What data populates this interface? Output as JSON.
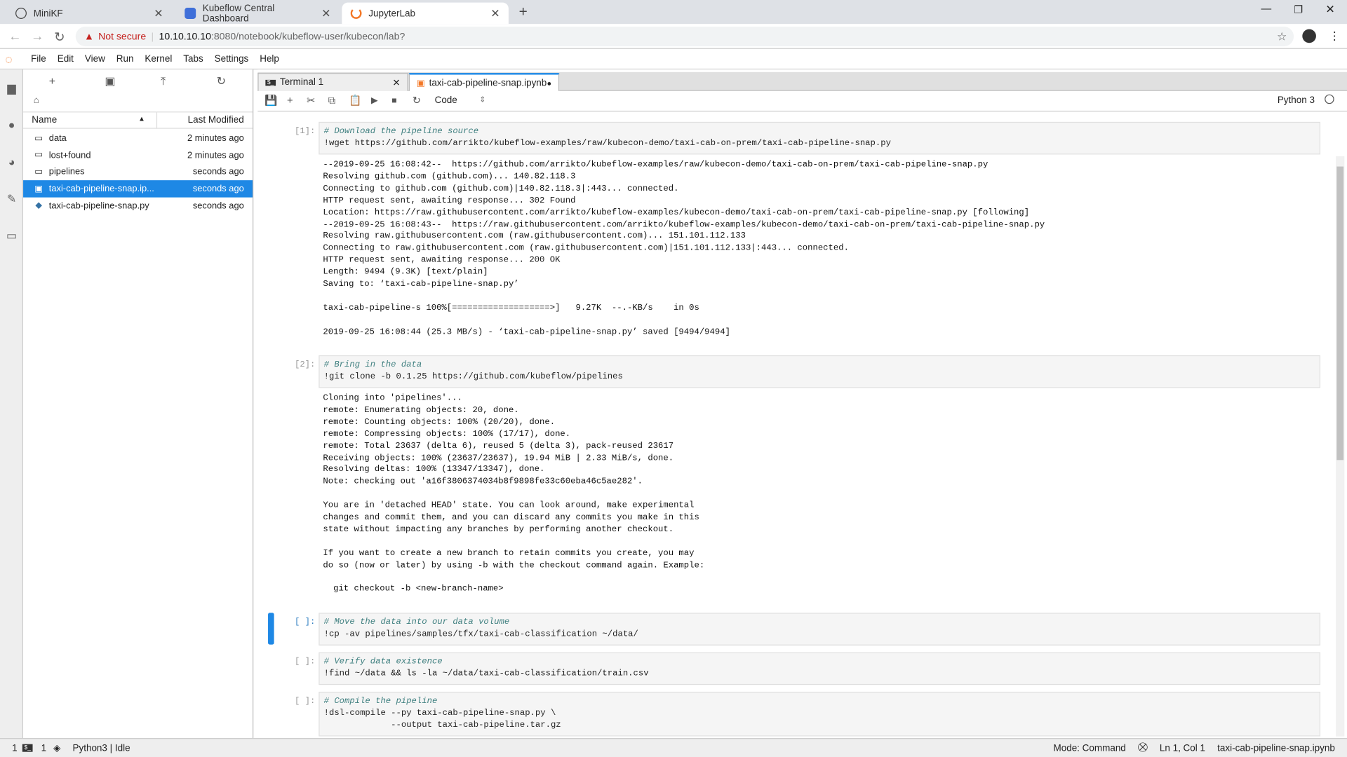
{
  "browser": {
    "tabs": [
      {
        "label": "MiniKF",
        "icon": "minikf-icon"
      },
      {
        "label": "Kubeflow Central Dashboard",
        "icon": "kubeflow-icon"
      },
      {
        "label": "JupyterLab",
        "icon": "jupyter-icon",
        "active": true
      }
    ],
    "new_tab": "+",
    "security": "Not secure",
    "url_host": "10.10.10.10",
    "url_rest": ":8080/notebook/kubeflow-user/kubecon/lab?"
  },
  "menubar": [
    "File",
    "Edit",
    "View",
    "Run",
    "Kernel",
    "Tabs",
    "Settings",
    "Help"
  ],
  "filebrowser": {
    "col_name": "Name",
    "col_modified": "Last Modified",
    "items": [
      {
        "name": "data",
        "modified": "2 minutes ago",
        "type": "folder"
      },
      {
        "name": "lost+found",
        "modified": "2 minutes ago",
        "type": "folder"
      },
      {
        "name": "pipelines",
        "modified": "seconds ago",
        "type": "folder"
      },
      {
        "name": "taxi-cab-pipeline-snap.ip...",
        "modified": "seconds ago",
        "type": "notebook",
        "selected": true
      },
      {
        "name": "taxi-cab-pipeline-snap.py",
        "modified": "seconds ago",
        "type": "python"
      }
    ]
  },
  "doc_tabs": [
    {
      "label": "Terminal 1"
    },
    {
      "label": "taxi-cab-pipeline-snap.ipynb",
      "active": true,
      "dirty": true
    }
  ],
  "toolbar": {
    "cell_type": "Code",
    "kernel": "Python 3"
  },
  "cells": [
    {
      "prompt": "[1]:",
      "code": [
        "# Download the pipeline source",
        "!wget https://github.com/arrikto/kubeflow-examples/raw/kubecon-demo/taxi-cab-on-prem/taxi-cab-pipeline-snap.py"
      ],
      "output": [
        "--2019-09-25 16:08:42--  https://github.com/arrikto/kubeflow-examples/raw/kubecon-demo/taxi-cab-on-prem/taxi-cab-pipeline-snap.py",
        "Resolving github.com (github.com)... 140.82.118.3",
        "Connecting to github.com (github.com)|140.82.118.3|:443... connected.",
        "HTTP request sent, awaiting response... 302 Found",
        "Location: https://raw.githubusercontent.com/arrikto/kubeflow-examples/kubecon-demo/taxi-cab-on-prem/taxi-cab-pipeline-snap.py [following]",
        "--2019-09-25 16:08:43--  https://raw.githubusercontent.com/arrikto/kubeflow-examples/kubecon-demo/taxi-cab-on-prem/taxi-cab-pipeline-snap.py",
        "Resolving raw.githubusercontent.com (raw.githubusercontent.com)... 151.101.112.133",
        "Connecting to raw.githubusercontent.com (raw.githubusercontent.com)|151.101.112.133|:443... connected.",
        "HTTP request sent, awaiting response... 200 OK",
        "Length: 9494 (9.3K) [text/plain]",
        "Saving to: ‘taxi-cab-pipeline-snap.py’",
        "",
        "taxi-cab-pipeline-s 100%[===================>]   9.27K  --.-KB/s    in 0s",
        "",
        "2019-09-25 16:08:44 (25.3 MB/s) - ‘taxi-cab-pipeline-snap.py’ saved [9494/9494]"
      ]
    },
    {
      "prompt": "[2]:",
      "code": [
        "# Bring in the data",
        "!git clone -b 0.1.25 https://github.com/kubeflow/pipelines"
      ],
      "output": [
        "Cloning into 'pipelines'...",
        "remote: Enumerating objects: 20, done.",
        "remote: Counting objects: 100% (20/20), done.",
        "remote: Compressing objects: 100% (17/17), done.",
        "remote: Total 23637 (delta 6), reused 5 (delta 3), pack-reused 23617",
        "Receiving objects: 100% (23637/23637), 19.94 MiB | 2.33 MiB/s, done.",
        "Resolving deltas: 100% (13347/13347), done.",
        "Note: checking out 'a16f3806374034b8f9898fe33c60eba46c5ae282'.",
        "",
        "You are in 'detached HEAD' state. You can look around, make experimental",
        "changes and commit them, and you can discard any commits you make in this",
        "state without impacting any branches by performing another checkout.",
        "",
        "If you want to create a new branch to retain commits you create, you may",
        "do so (now or later) by using -b with the checkout command again. Example:",
        "",
        "  git checkout -b <new-branch-name>"
      ]
    },
    {
      "prompt": "[ ]:",
      "active": true,
      "code": [
        "# Move the data into our data volume",
        "!cp -av pipelines/samples/tfx/taxi-cab-classification ~/data/"
      ],
      "output": []
    },
    {
      "prompt": "[ ]:",
      "code": [
        "# Verify data existence",
        "!find ~/data && ls -la ~/data/taxi-cab-classification/train.csv"
      ],
      "output": []
    },
    {
      "prompt": "[ ]:",
      "code": [
        "# Compile the pipeline",
        "!dsl-compile --py taxi-cab-pipeline-snap.py \\",
        "             --output taxi-cab-pipeline.tar.gz"
      ],
      "output": []
    }
  ],
  "status": {
    "left_num1": "1",
    "left_num2": "1",
    "kernel_status": "Python3 | Idle",
    "mode": "Mode: Command",
    "position": "Ln 1, Col 1",
    "filename": "taxi-cab-pipeline-snap.ipynb"
  },
  "colors": {
    "accent": "#1e88e5",
    "jupyter_orange": "#f37726",
    "warning": "#c5221f"
  }
}
